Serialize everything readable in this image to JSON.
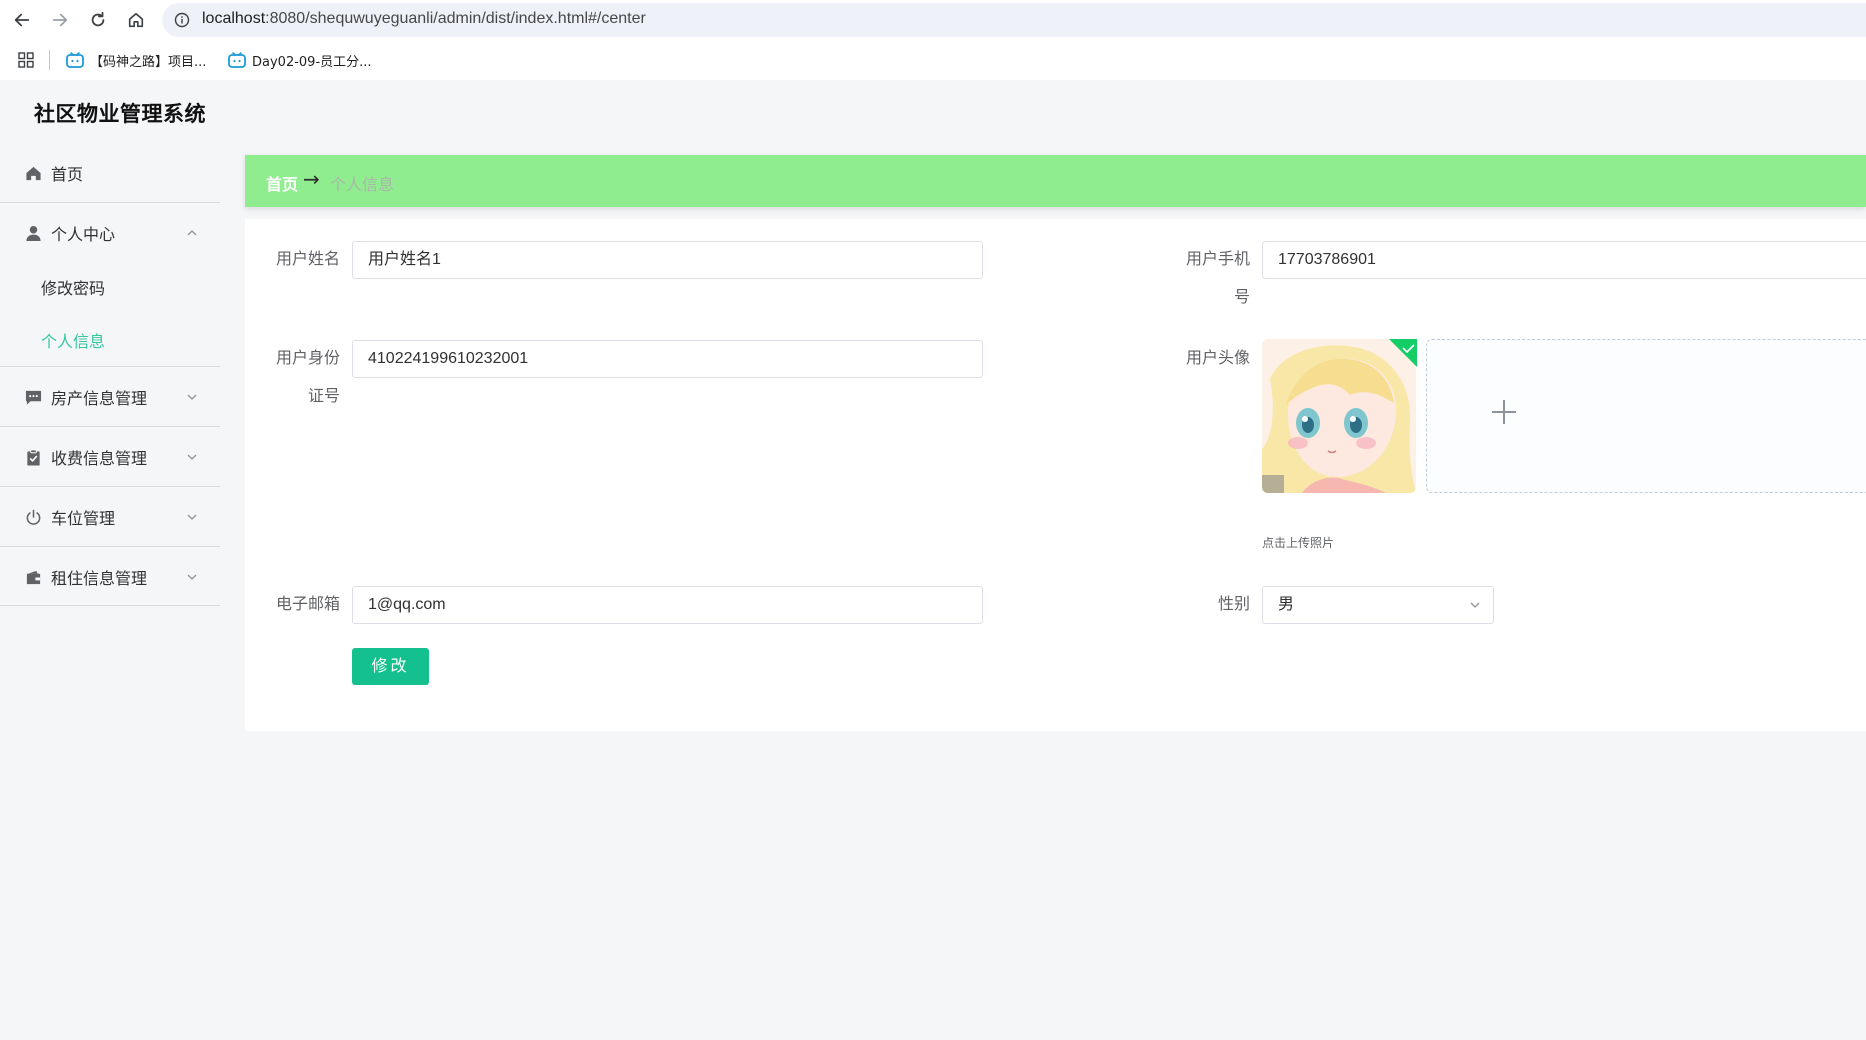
{
  "browser": {
    "url_host": "localhost",
    "url_rest": ":8080/shequwuyeguanli/admin/dist/index.html#/center",
    "bookmarks": [
      {
        "label": "【码神之路】项目..."
      },
      {
        "label": "Day02-09-员工分..."
      }
    ],
    "icons": {
      "back": "back-arrow-icon",
      "forward": "forward-arrow-icon",
      "reload": "reload-icon",
      "home": "home-icon",
      "info": "info-icon",
      "apps": "apps-grid-icon"
    }
  },
  "app": {
    "title": "社区物业管理系统",
    "accent_color": "#13c08e",
    "breadcrumb_bg": "#90ed8f"
  },
  "sidebar": {
    "home": {
      "label": "首页",
      "icon": "house-icon"
    },
    "personal_center": {
      "label": "个人中心",
      "icon": "user-icon",
      "expanded": true,
      "children": [
        {
          "label": "修改密码",
          "active": false
        },
        {
          "label": "个人信息",
          "active": true
        }
      ]
    },
    "groups": [
      {
        "label": "房产信息管理",
        "icon": "chat-icon"
      },
      {
        "label": "收费信息管理",
        "icon": "clipboard-check-icon"
      },
      {
        "label": "车位管理",
        "icon": "power-icon"
      },
      {
        "label": "租住信息管理",
        "icon": "wallet-icon"
      }
    ]
  },
  "breadcrumb": {
    "home": "首页",
    "arrow": "→",
    "current": "个人信息"
  },
  "form": {
    "username": {
      "label": "用户姓名",
      "value": "用户姓名1"
    },
    "phone": {
      "label_line1": "用户手机",
      "label_line2": "号",
      "value": "17703786901"
    },
    "id_card": {
      "label_line1": "用户身份",
      "label_line2": "证号",
      "value": "410224199610232001"
    },
    "avatar": {
      "label": "用户头像",
      "hint": "点击上传照片",
      "uploaded": true
    },
    "email": {
      "label": "电子邮箱",
      "value": "1@qq.com"
    },
    "gender": {
      "label": "性别",
      "value": "男"
    },
    "submit_label": "修改"
  }
}
